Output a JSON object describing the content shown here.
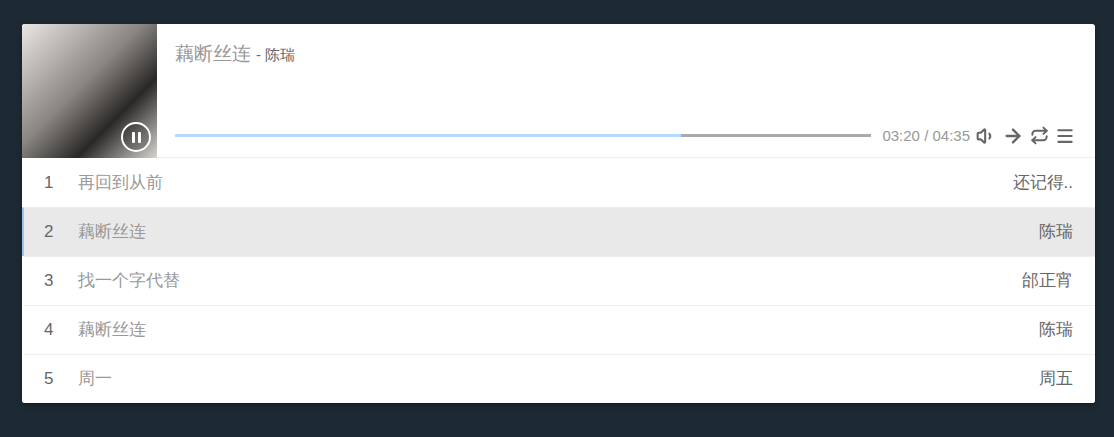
{
  "player": {
    "title": "藕断丝连",
    "author": "- 陈瑞",
    "playing": true,
    "level": 0.727,
    "time": "03:20 / 04:35"
  },
  "playlist": [
    {
      "index": "1",
      "title": "再回到从前",
      "author": "还记得..",
      "selected": false
    },
    {
      "index": "2",
      "title": "藕断丝连",
      "author": "陈瑞",
      "selected": true
    },
    {
      "index": "3",
      "title": "找一个字代替",
      "author": "邰正宵",
      "selected": false
    },
    {
      "index": "4",
      "title": "藕断丝连",
      "author": "陈瑞",
      "selected": false
    },
    {
      "index": "5",
      "title": "周一",
      "author": "周五",
      "selected": false
    }
  ]
}
